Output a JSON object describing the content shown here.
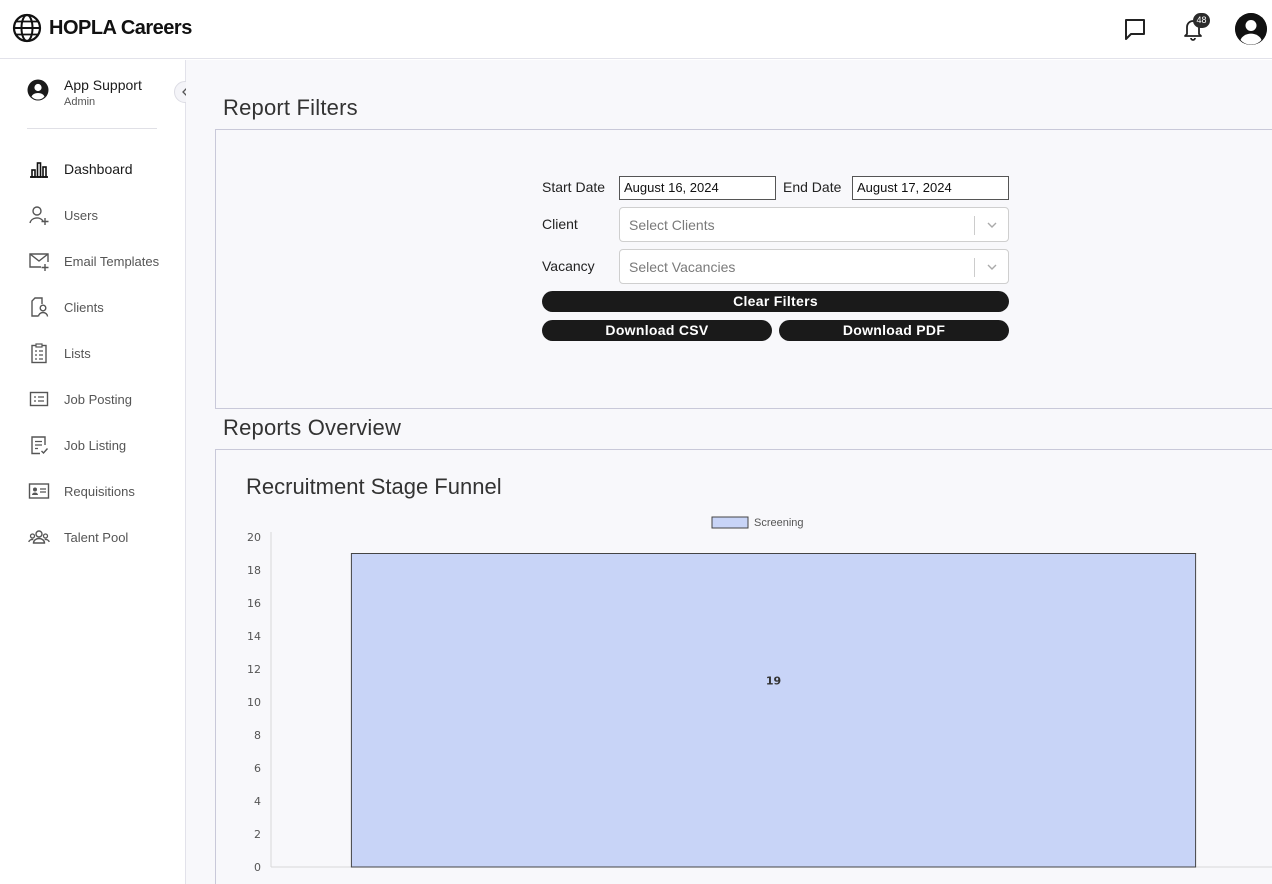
{
  "app": {
    "brand": "HOPLA Careers",
    "notification_count": "48"
  },
  "user": {
    "name": "App Support",
    "role": "Admin"
  },
  "sidebar": {
    "items": [
      {
        "label": "Dashboard",
        "icon": "bar-chart-icon",
        "active": true
      },
      {
        "label": "Users",
        "icon": "add-user-icon",
        "active": false
      },
      {
        "label": "Email Templates",
        "icon": "mail-plus-icon",
        "active": false
      },
      {
        "label": "Clients",
        "icon": "client-folder-icon",
        "active": false
      },
      {
        "label": "Lists",
        "icon": "clipboard-list-icon",
        "active": false
      },
      {
        "label": "Job Posting",
        "icon": "job-posting-icon",
        "active": false
      },
      {
        "label": "Job Listing",
        "icon": "job-listing-icon",
        "active": false
      },
      {
        "label": "Requisitions",
        "icon": "id-card-icon",
        "active": false
      },
      {
        "label": "Talent Pool",
        "icon": "group-icon",
        "active": false
      }
    ]
  },
  "filters": {
    "section_title": "Report Filters",
    "start_date_label": "Start Date",
    "start_date_value": "August 16, 2024",
    "end_date_label": "End Date",
    "end_date_value": "August 17, 2024",
    "client_label": "Client",
    "client_placeholder": "Select Clients",
    "vacancy_label": "Vacancy",
    "vacancy_placeholder": "Select Vacancies",
    "clear_label": "Clear Filters",
    "csv_label": "Download CSV",
    "pdf_label": "Download PDF"
  },
  "overview": {
    "section_title": "Reports Overview"
  },
  "chart_data": {
    "type": "bar",
    "title": "Recruitment Stage Funnel",
    "categories": [
      ""
    ],
    "series": [
      {
        "name": "Screening",
        "values": [
          19
        ],
        "color": "#c8d4f7",
        "border": "#444444"
      }
    ],
    "data_labels": [
      "19"
    ],
    "y_ticks": [
      0,
      2,
      4,
      6,
      8,
      10,
      12,
      14,
      16,
      18,
      20
    ],
    "ylim": [
      0,
      20
    ],
    "legend_position": "top-center",
    "grid": false
  },
  "colors": {
    "button_bg": "#1a1a1a",
    "panel_bg": "#f8f8fb",
    "panel_border": "#c9c9d9",
    "bar_fill": "#c8d4f7"
  }
}
